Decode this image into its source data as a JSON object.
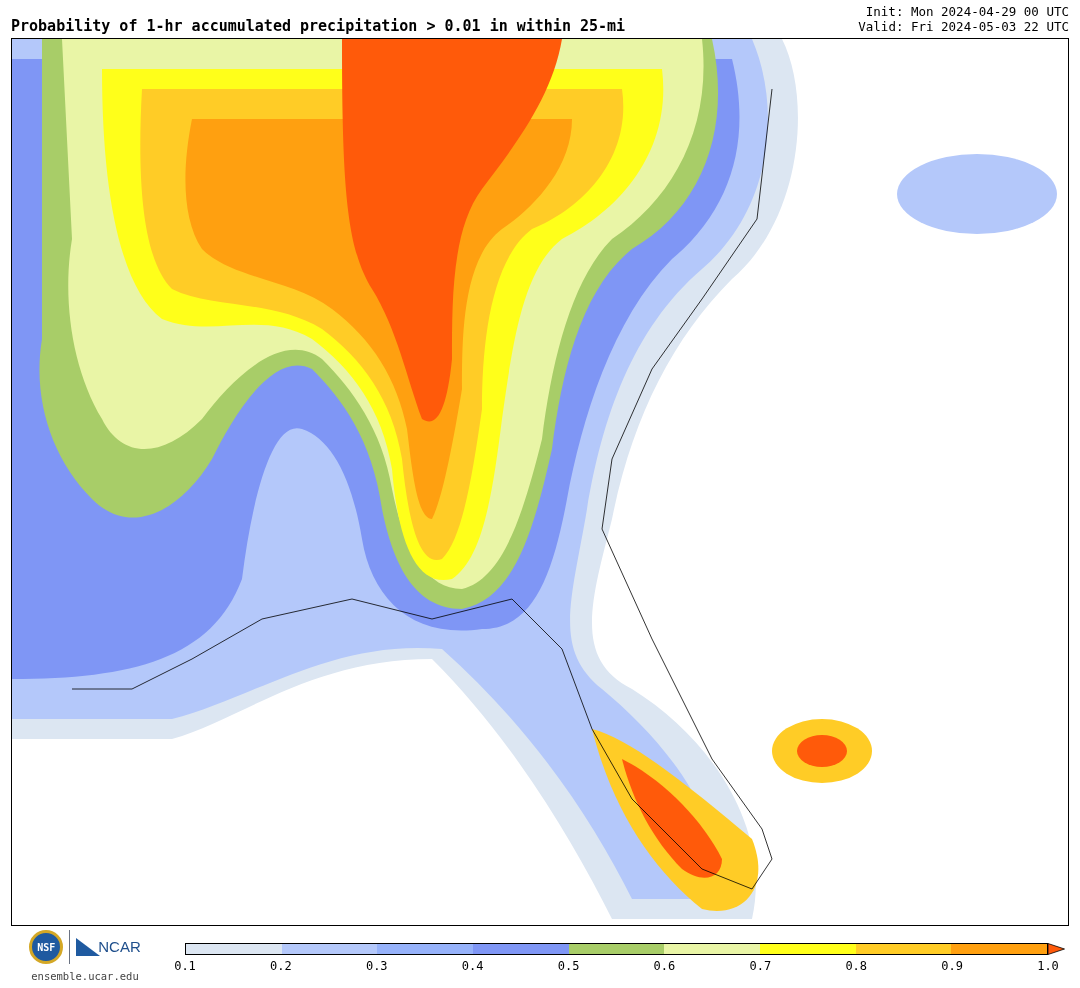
{
  "title": "Probability of 1-hr accumulated precipitation > 0.01 in within 25-mi",
  "init": "Init: Mon 2024-04-29 00 UTC",
  "valid": "Valid: Fri 2024-05-03 22 UTC",
  "logos": {
    "nsf": "NSF",
    "ncar": "NCAR",
    "url": "ensemble.ucar.edu"
  },
  "colorbar": {
    "bins": [
      {
        "color": "#dce6f2"
      },
      {
        "color": "#b4c8fa"
      },
      {
        "color": "#96b2fa"
      },
      {
        "color": "#7f96f5"
      },
      {
        "color": "#a8cd68"
      },
      {
        "color": "#e9f5a6"
      },
      {
        "color": "#ffff1a"
      },
      {
        "color": "#ffcc26"
      },
      {
        "color": "#ffa010"
      }
    ],
    "extend": {
      "color": "#ff5a0a"
    },
    "ticks": [
      "0.1",
      "0.2",
      "0.3",
      "0.4",
      "0.5",
      "0.6",
      "0.7",
      "0.8",
      "0.9",
      "1.0"
    ]
  }
}
